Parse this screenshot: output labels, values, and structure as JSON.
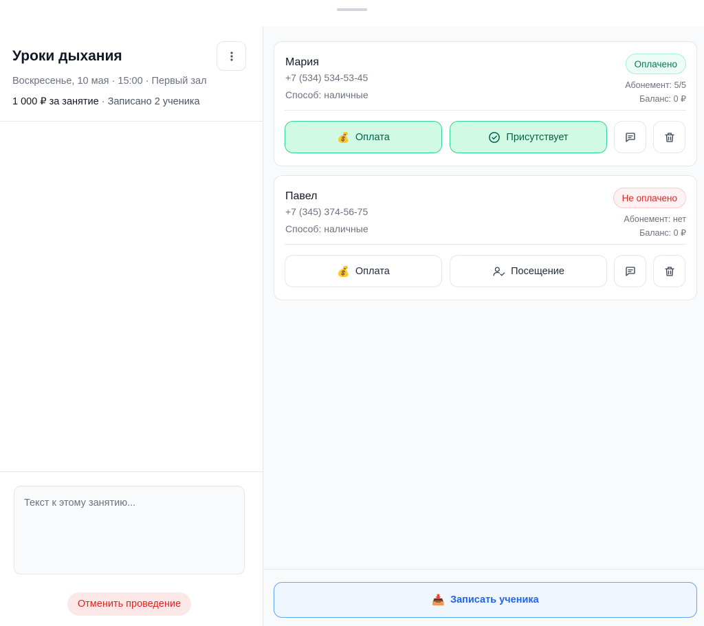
{
  "lesson": {
    "title": "Уроки дыхания",
    "meta": "Воскресенье, 10 мая · 15:00 · Первый зал",
    "price": "1 000 ₽ за занятие",
    "separator": " · ",
    "enrolled": "Записано 2 ученика"
  },
  "note": {
    "placeholder": "Текст к этому занятию..."
  },
  "cancel_label": "Отменить проведение",
  "students": [
    {
      "name": "Мария",
      "phone": "+7 (534) 534-53-45",
      "method": "Способ: наличные",
      "status": "Оплачено",
      "subscription": "Абонемент: 5/5",
      "balance": "Баланс: 0 ₽",
      "pay_label": "Оплата",
      "attendance_label": "Присутствует"
    },
    {
      "name": "Павел",
      "phone": "+7 (345) 374-56-75",
      "method": "Способ: наличные",
      "status": "Не оплачено",
      "subscription": "Абонемент: нет",
      "balance": "Баланс: 0 ₽",
      "pay_label": "Оплата",
      "attendance_label": "Посещение"
    }
  ],
  "icons": {
    "money": "💰",
    "enroll": "📥"
  },
  "enroll_label": "Записать ученика",
  "colors": {
    "paid": "#047857",
    "unpaid": "#dc2626",
    "accent": "#2563eb"
  }
}
